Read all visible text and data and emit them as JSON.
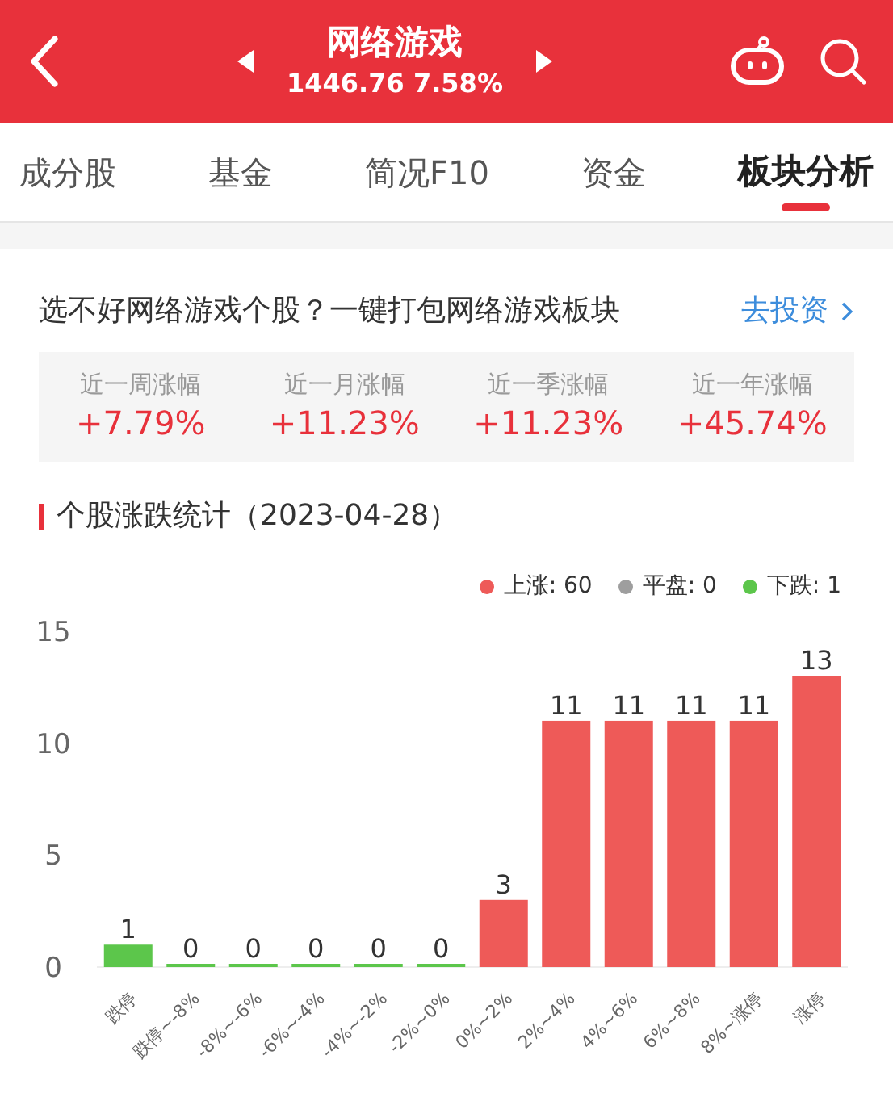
{
  "header": {
    "title": "网络游戏",
    "quote": "1446.76 7.58%"
  },
  "tabs": [
    {
      "label": "成分股",
      "selected": false
    },
    {
      "label": "基金",
      "selected": false
    },
    {
      "label": "简况F10",
      "selected": false
    },
    {
      "label": "资金",
      "selected": false
    },
    {
      "label": "板块分析",
      "selected": true
    }
  ],
  "promo": {
    "text": "选不好网络游戏个股？一键打包网络游戏板块",
    "link": "去投资"
  },
  "returns": [
    {
      "label": "近一周涨幅",
      "value": "+7.79%"
    },
    {
      "label": "近一月涨幅",
      "value": "+11.23%"
    },
    {
      "label": "近一季涨幅",
      "value": "+11.23%"
    },
    {
      "label": "近一年涨幅",
      "value": "+45.74%"
    }
  ],
  "stats": {
    "title": "个股涨跌统计（2023-04-28）",
    "legend": [
      {
        "label": "上涨: 60",
        "color": "#ee5a58"
      },
      {
        "label": "平盘: 0",
        "color": "#9e9e9e"
      },
      {
        "label": "下跌: 1",
        "color": "#5cc64b"
      }
    ],
    "chart_data": {
      "type": "bar",
      "categories": [
        "跌停",
        "跌停~-8%",
        "-8%~-6%",
        "-6%~-4%",
        "-4%~-2%",
        "-2%~0%",
        "0%~2%",
        "2%~4%",
        "4%~6%",
        "6%~8%",
        "8%~涨停",
        "涨停"
      ],
      "series": [
        {
          "color": "#5cc64b",
          "values": [
            1,
            0,
            0,
            0,
            0,
            0,
            null,
            null,
            null,
            null,
            null,
            null
          ]
        },
        {
          "color": "#ee5a58",
          "values": [
            null,
            null,
            null,
            null,
            null,
            null,
            3,
            11,
            11,
            11,
            11,
            13
          ]
        }
      ],
      "ylim": [
        0,
        15
      ],
      "yticks": [
        0,
        5,
        10,
        15
      ],
      "data_labels": true
    }
  }
}
